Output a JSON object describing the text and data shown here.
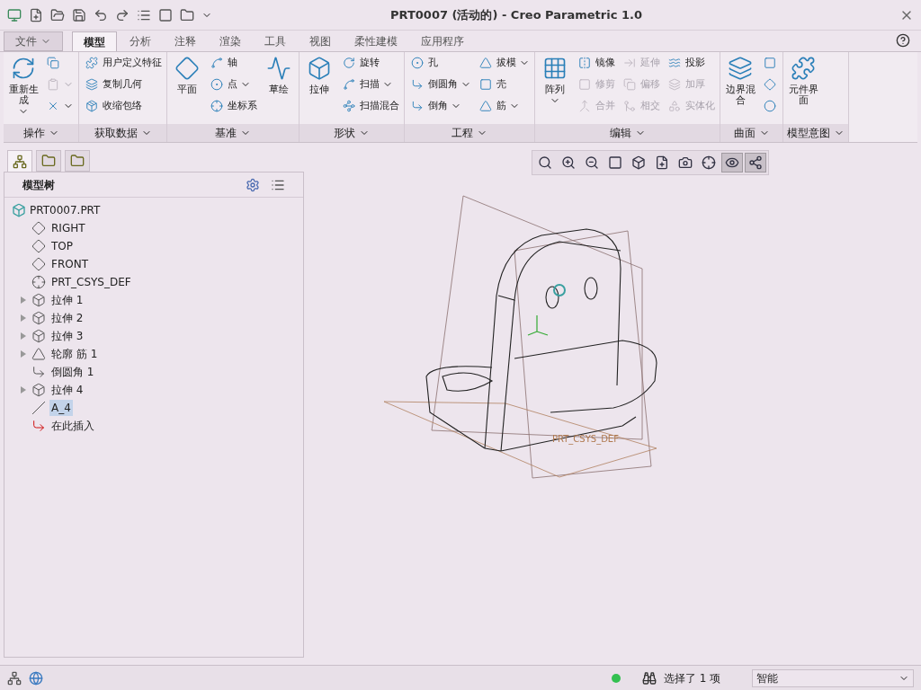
{
  "window": {
    "title": "PRT0007 (活动的) - Creo Parametric 1.0"
  },
  "tabs": [
    {
      "label": "文件",
      "kind": "menu",
      "selected": false
    },
    {
      "label": "模型",
      "kind": "tab",
      "selected": true
    },
    {
      "label": "分析",
      "kind": "tab",
      "selected": false
    },
    {
      "label": "注释",
      "kind": "tab",
      "selected": false
    },
    {
      "label": "渲染",
      "kind": "tab",
      "selected": false
    },
    {
      "label": "工具",
      "kind": "tab",
      "selected": false
    },
    {
      "label": "视图",
      "kind": "tab",
      "selected": false
    },
    {
      "label": "柔性建模",
      "kind": "tab",
      "selected": false
    },
    {
      "label": "应用程序",
      "kind": "tab",
      "selected": false
    }
  ],
  "ribbon": [
    {
      "label": "操作",
      "columns": [
        [
          {
            "kind": "large",
            "label": "重新生成",
            "dropdown": true,
            "disabled": false
          }
        ],
        [
          {
            "kind": "icon",
            "dropdown": false,
            "disabled": false
          },
          {
            "kind": "icon",
            "dropdown": true,
            "disabled": true
          },
          {
            "kind": "icon",
            "dropdown": true,
            "disabled": false
          }
        ]
      ]
    },
    {
      "label": "获取数据",
      "columns": [
        [
          {
            "kind": "small",
            "label": "用户定义特征",
            "dropdown": false,
            "disabled": false
          },
          {
            "kind": "small",
            "label": "复制几何",
            "dropdown": false,
            "disabled": false
          },
          {
            "kind": "small",
            "label": "收缩包络",
            "dropdown": false,
            "disabled": false
          }
        ]
      ]
    },
    {
      "label": "基准",
      "columns": [
        [
          {
            "kind": "large",
            "label": "平面",
            "dropdown": false,
            "disabled": false
          }
        ],
        [
          {
            "kind": "small",
            "label": "轴",
            "dropdown": false,
            "disabled": false
          },
          {
            "kind": "small",
            "label": "点",
            "dropdown": true,
            "disabled": false
          },
          {
            "kind": "small",
            "label": "坐标系",
            "dropdown": false,
            "disabled": false
          }
        ],
        [
          {
            "kind": "large",
            "label": "草绘",
            "dropdown": false,
            "disabled": false
          }
        ]
      ]
    },
    {
      "label": "形状",
      "columns": [
        [
          {
            "kind": "large",
            "label": "拉伸",
            "dropdown": false,
            "disabled": false
          }
        ],
        [
          {
            "kind": "small",
            "label": "旋转",
            "dropdown": false,
            "disabled": false
          },
          {
            "kind": "small",
            "label": "扫描",
            "dropdown": true,
            "disabled": false
          },
          {
            "kind": "small",
            "label": "扫描混合",
            "dropdown": false,
            "disabled": false
          }
        ]
      ]
    },
    {
      "label": "工程",
      "columns": [
        [
          {
            "kind": "small",
            "label": "孔",
            "dropdown": false,
            "disabled": false
          },
          {
            "kind": "small",
            "label": "倒圆角",
            "dropdown": true,
            "disabled": false
          },
          {
            "kind": "small",
            "label": "倒角",
            "dropdown": true,
            "disabled": false
          }
        ],
        [
          {
            "kind": "small",
            "label": "拔模",
            "dropdown": true,
            "disabled": false
          },
          {
            "kind": "small",
            "label": "壳",
            "dropdown": false,
            "disabled": false
          },
          {
            "kind": "small",
            "label": "筋",
            "dropdown": true,
            "disabled": false
          }
        ]
      ]
    },
    {
      "label": "编辑",
      "columns": [
        [
          {
            "kind": "large",
            "label": "阵列",
            "dropdown": true,
            "disabled": false
          }
        ],
        [
          {
            "kind": "small",
            "label": "镜像",
            "dropdown": false,
            "disabled": false
          },
          {
            "kind": "small",
            "label": "修剪",
            "dropdown": false,
            "disabled": true
          },
          {
            "kind": "small",
            "label": "合并",
            "dropdown": false,
            "disabled": true
          }
        ],
        [
          {
            "kind": "small",
            "label": "延伸",
            "dropdown": false,
            "disabled": true
          },
          {
            "kind": "small",
            "label": "偏移",
            "dropdown": false,
            "disabled": true
          },
          {
            "kind": "small",
            "label": "相交",
            "dropdown": false,
            "disabled": true
          }
        ],
        [
          {
            "kind": "small",
            "label": "投影",
            "dropdown": false,
            "disabled": false
          },
          {
            "kind": "small",
            "label": "加厚",
            "dropdown": false,
            "disabled": true
          },
          {
            "kind": "small",
            "label": "实体化",
            "dropdown": false,
            "disabled": true
          }
        ]
      ]
    },
    {
      "label": "曲面",
      "columns": [
        [
          {
            "kind": "large",
            "label": "边界混合",
            "dropdown": false,
            "disabled": false
          }
        ],
        [
          {
            "kind": "icon",
            "dropdown": false,
            "disabled": false
          },
          {
            "kind": "icon",
            "dropdown": false,
            "disabled": false
          },
          {
            "kind": "icon",
            "dropdown": false,
            "disabled": false
          }
        ]
      ]
    },
    {
      "label": "模型意图",
      "columns": [
        [
          {
            "kind": "large",
            "label": "元件界面",
            "dropdown": false,
            "disabled": false
          }
        ]
      ]
    }
  ],
  "view_toolbar": [
    {
      "selected": false
    },
    {
      "selected": false
    },
    {
      "selected": false
    },
    {
      "selected": false
    },
    {
      "selected": false
    },
    {
      "selected": false
    },
    {
      "selected": false
    },
    {
      "selected": false
    },
    {
      "selected": true
    },
    {
      "selected": true
    }
  ],
  "navigator_tabs": [
    {
      "selected": true
    },
    {
      "selected": false
    },
    {
      "selected": false
    }
  ],
  "model_tree": {
    "title": "模型树",
    "root": {
      "label": "PRT0007.PRT",
      "children": [
        {
          "label": "RIGHT",
          "kind": "plane",
          "expandable": false,
          "selected": false
        },
        {
          "label": "TOP",
          "kind": "plane",
          "expandable": false,
          "selected": false
        },
        {
          "label": "FRONT",
          "kind": "plane",
          "expandable": false,
          "selected": false
        },
        {
          "label": "PRT_CSYS_DEF",
          "kind": "csys",
          "expandable": false,
          "selected": false
        },
        {
          "label": "拉伸 1",
          "kind": "extrude",
          "expandable": true,
          "selected": false
        },
        {
          "label": "拉伸 2",
          "kind": "extrude",
          "expandable": true,
          "selected": false
        },
        {
          "label": "拉伸 3",
          "kind": "extrude",
          "expandable": true,
          "selected": false
        },
        {
          "label": "轮廓 筋 1",
          "kind": "rib",
          "expandable": true,
          "selected": false
        },
        {
          "label": "倒圆角 1",
          "kind": "round",
          "expandable": false,
          "selected": false
        },
        {
          "label": "拉伸 4",
          "kind": "extrude",
          "expandable": true,
          "selected": false
        },
        {
          "label": "A_4",
          "kind": "axis",
          "expandable": false,
          "selected": true
        },
        {
          "label": "在此插入",
          "kind": "insert",
          "expandable": false,
          "selected": false
        }
      ]
    }
  },
  "viewport": {
    "csys_label": "PRT_CSYS_DEF"
  },
  "status_bar": {
    "message": "选择了 1 项",
    "filter": "智能"
  }
}
